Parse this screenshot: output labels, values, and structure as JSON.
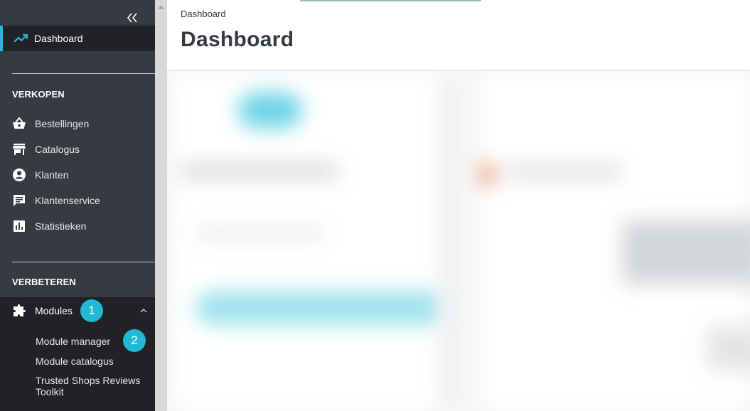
{
  "sidebar": {
    "collapse_icon": "double-chevron-left-icon",
    "dashboard": {
      "label": "Dashboard",
      "icon": "trending-up-icon"
    },
    "sections": [
      {
        "title": "VERKOPEN",
        "items": [
          {
            "label": "Bestellingen",
            "icon": "shopping-basket-icon"
          },
          {
            "label": "Catalogus",
            "icon": "store-icon"
          },
          {
            "label": "Klanten",
            "icon": "account-circle-icon"
          },
          {
            "label": "Klantenservice",
            "icon": "chat-icon"
          },
          {
            "label": "Statistieken",
            "icon": "bar-chart-icon"
          }
        ]
      },
      {
        "title": "VERBETEREN",
        "modules": {
          "label": "Modules",
          "icon": "puzzle-icon",
          "badge": "1",
          "children": [
            {
              "label": "Module manager",
              "badge": "2"
            },
            {
              "label": "Module catalogus"
            },
            {
              "label": "Trusted Shops Reviews Toolkit"
            }
          ]
        }
      }
    ]
  },
  "header": {
    "breadcrumb": "Dashboard",
    "title": "Dashboard"
  },
  "colors": {
    "sidebar_bg": "#363a41",
    "active_bg": "#202226",
    "accent": "#25b9d7",
    "badge": "#21b9d4"
  }
}
